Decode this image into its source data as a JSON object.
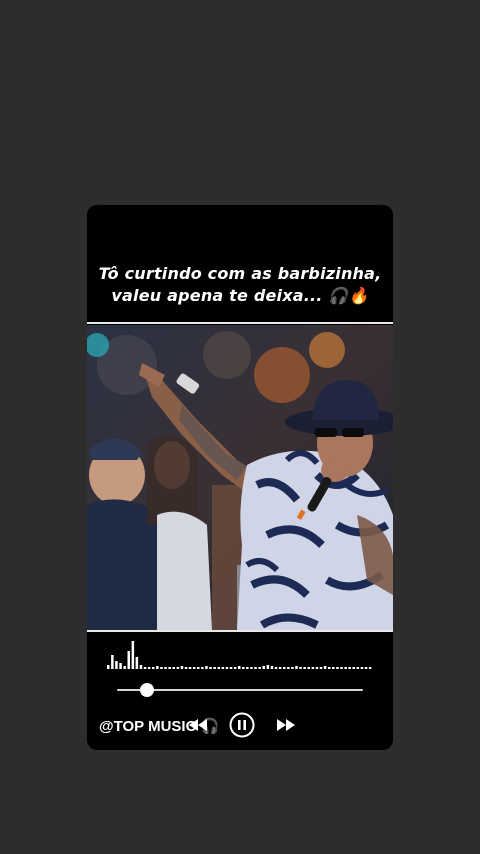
{
  "caption": {
    "line1": "Tô curtindo com as barbizinha,",
    "line2": "valeu apena te deixa... 🎧🔥"
  },
  "player": {
    "progress": 0.12,
    "watermark": "@TOP MUSIC 🎧",
    "controls": [
      "rewind-icon",
      "pause-icon",
      "fast-forward-icon"
    ]
  },
  "colors": {
    "background": "#2e2d2d",
    "card": "#000000",
    "text": "#ffffff"
  }
}
